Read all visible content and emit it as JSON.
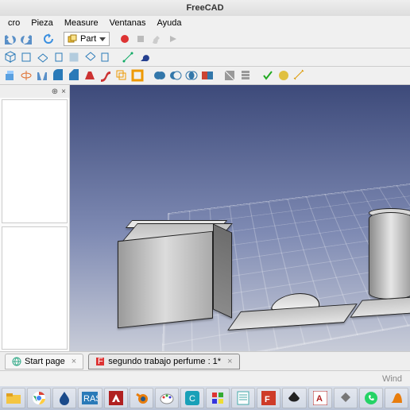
{
  "title": "FreeCAD",
  "menus": [
    "cro",
    "Pieza",
    "Measure",
    "Ventanas",
    "Ayuda"
  ],
  "workbench": {
    "label": "Part"
  },
  "tabs": [
    {
      "label": "Start page",
      "active": false
    },
    {
      "label": "segundo trabajo perfume : 1*",
      "active": true
    }
  ],
  "status": {
    "text": "Wind"
  },
  "taskbarApps": [
    "file-explorer",
    "chrome",
    "waterdrop",
    "ide",
    "autocad-red",
    "blender",
    "paint",
    "cortana",
    "color-picker",
    "notepad",
    "freecad",
    "inkscape",
    "autocad-a",
    "teamspeak",
    "whatsapp",
    "slicer"
  ]
}
